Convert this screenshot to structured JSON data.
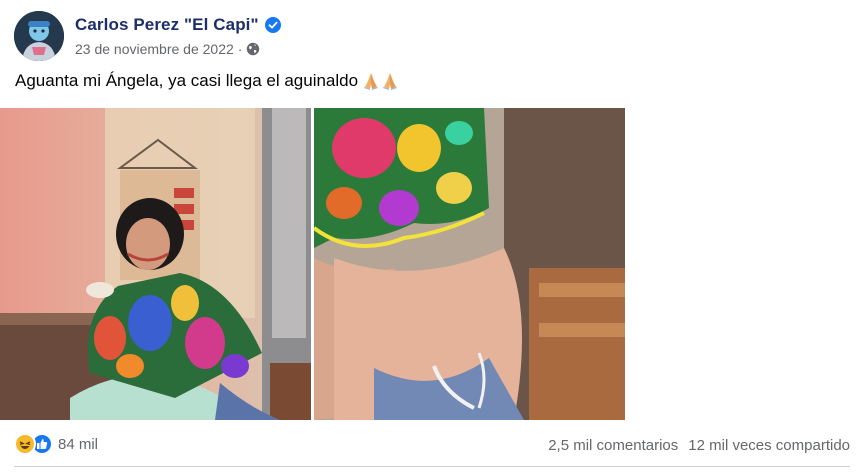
{
  "post": {
    "author_name": "Carlos Perez \"El Capi\"",
    "date": "23 de noviembre de 2022",
    "separator": "·",
    "audience_icon": "globe-icon",
    "verified_icon": "verified-badge-icon",
    "text": "Aguanta mi Ángela, ya casi llega el aguinaldo",
    "text_emoji": "folded-hands-icon"
  },
  "media": {
    "images": [
      {
        "name": "photo-left",
        "icon": "photo"
      },
      {
        "name": "photo-right",
        "icon": "photo"
      }
    ]
  },
  "footer": {
    "reactions": [
      "haha-reaction-icon",
      "like-reaction-icon"
    ],
    "reaction_count": "84 mil",
    "comments": "2,5 mil comentarios",
    "shares": "12 mil veces compartido"
  },
  "colors": {
    "author": "#1d2f6b",
    "meta": "#65676b",
    "like": "#1877f2",
    "haha": "#f7b928",
    "divider": "#ced0d4"
  }
}
